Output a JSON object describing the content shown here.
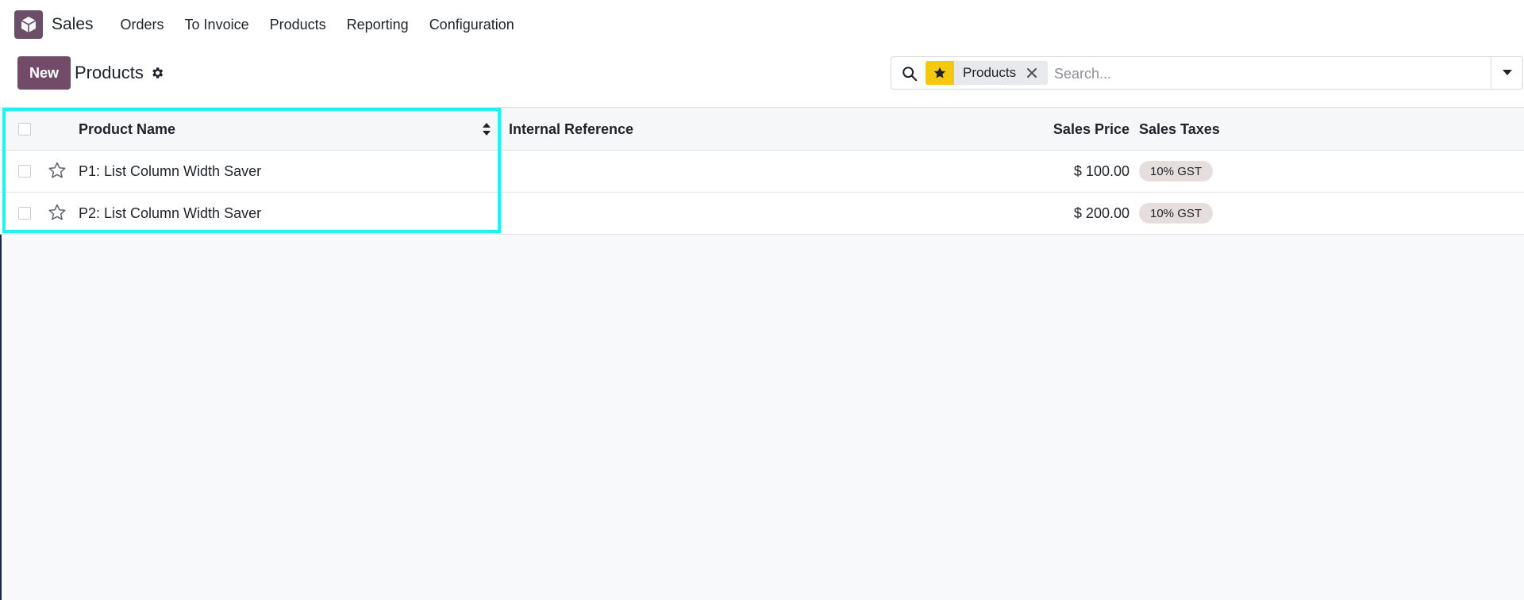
{
  "navbar": {
    "app_name": "Sales",
    "menu": [
      "Orders",
      "To Invoice",
      "Products",
      "Reporting",
      "Configuration"
    ]
  },
  "control_panel": {
    "new_label": "New",
    "title": "Products"
  },
  "search": {
    "facet_icon": "star-icon",
    "facet_label": "Products",
    "placeholder": "Search..."
  },
  "table": {
    "columns": [
      "Product Name",
      "Internal Reference",
      "Sales Price",
      "Sales Taxes"
    ],
    "rows": [
      {
        "name": "P1: List Column Width Saver",
        "internal_reference": "",
        "sales_price": "$ 100.00",
        "sales_taxes": "10% GST"
      },
      {
        "name": "P2: List Column Width Saver",
        "internal_reference": "",
        "sales_price": "$ 200.00",
        "sales_taxes": "10% GST"
      }
    ]
  },
  "colors": {
    "brand": "#714b67",
    "facet_accent": "#f3c80d",
    "highlight": "#1ff2f2"
  }
}
